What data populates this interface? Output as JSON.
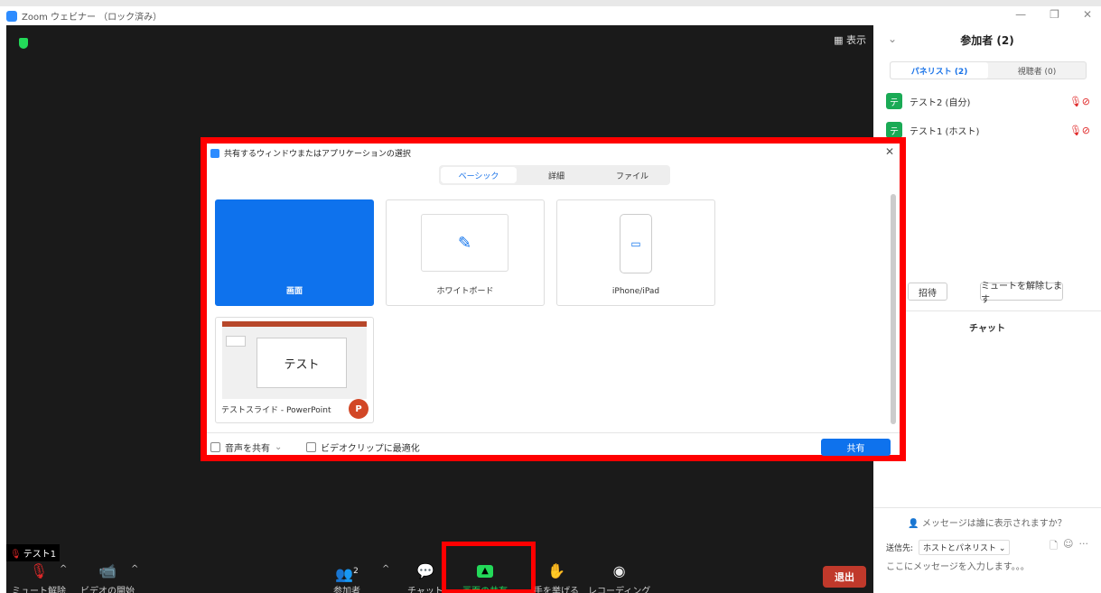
{
  "window": {
    "title": "Zoom ウェビナー （ロック済み）",
    "minimize": "—",
    "maximize": "❐",
    "close": "✕"
  },
  "video": {
    "view_label": "▦ 表示"
  },
  "toolbar": {
    "self_name": "テスト1",
    "mute_label": "ミュート解除",
    "video_label": "ビデオの開始",
    "participants_label": "参加者",
    "participants_count": "2",
    "chat_label": "チャット",
    "share_label": "画面の共有",
    "raise_hand_label": "手を挙げる",
    "recording_label": "レコーディング",
    "leave_label": "退出"
  },
  "panel": {
    "title": "参加者 (2)",
    "tabs": [
      {
        "label": "パネリスト (2)",
        "active": true
      },
      {
        "label": "視聴者 (0)",
        "active": false
      }
    ],
    "participants": [
      {
        "avatar": "テ",
        "name": "テスト2 (自分)"
      },
      {
        "avatar": "テ",
        "name": "テスト1 (ホスト)"
      }
    ],
    "invite_label": "招待",
    "unmute_all_label": "ミュートを解除します",
    "chat_title": "チャット",
    "chat_hint": "メッセージは誰に表示されますか？",
    "send_to_label": "送信先:",
    "send_to_value": "ホストとパネリスト ⌄",
    "chat_placeholder": "ここにメッセージを入力します。。。"
  },
  "modal": {
    "title": "共有するウィンドウまたはアプリケーションの選択",
    "tabs": [
      {
        "label": "ベーシック",
        "active": true
      },
      {
        "label": "詳細",
        "active": false
      },
      {
        "label": "ファイル",
        "active": false
      }
    ],
    "tiles": {
      "screen": "画面",
      "whiteboard": "ホワイトボード",
      "iphone": "iPhone/iPad",
      "ppt_label": "テストスライド - PowerPoint",
      "ppt_slide_text": "テスト",
      "ppt_icon_letter": "P"
    },
    "share_audio_label": "音声を共有",
    "optimize_video_label": "ビデオクリップに最適化",
    "share_button": "共有"
  }
}
